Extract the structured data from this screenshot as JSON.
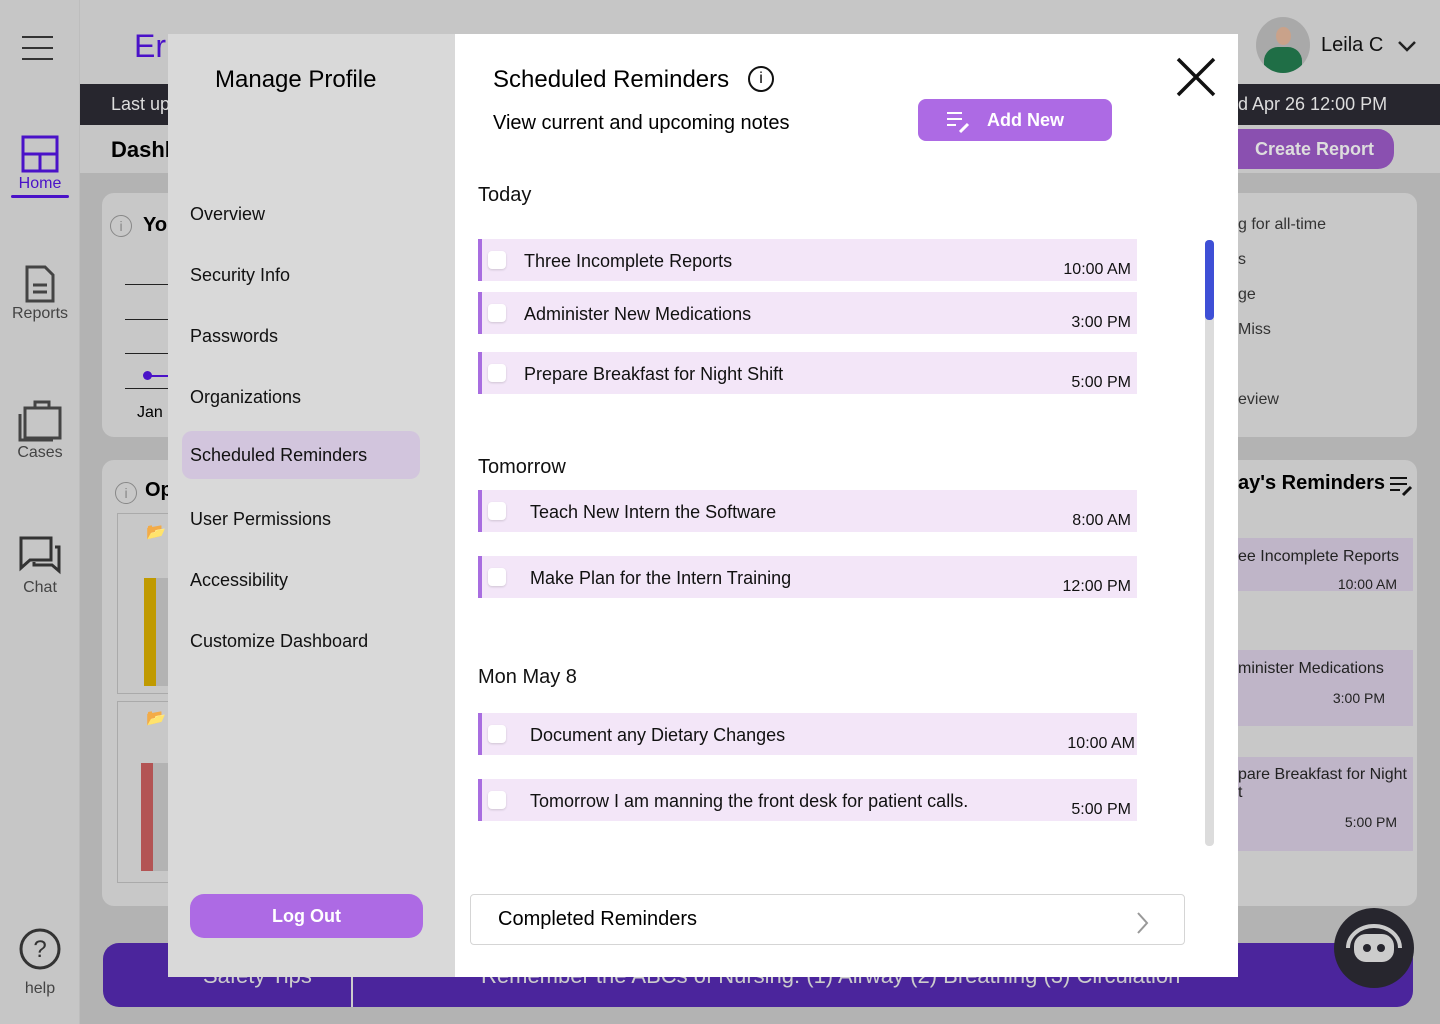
{
  "background": {
    "logo_fragment": "Err",
    "user_name": "Leila C",
    "last_updated_left": "Last up",
    "last_updated_right": "d Apr 26 12:00 PM",
    "dashboard_fragment": "Dashb",
    "create_report": "Create Report",
    "card1_title_fragment": "Yo",
    "card1_axis_label": "Jan",
    "card2_title_fragment": "Op",
    "stats_lines": [
      "g for all-time",
      "s",
      "ge",
      "Miss",
      "eview"
    ],
    "reminders_title": "ay's Reminders",
    "reminders": [
      {
        "title": "ee Incomplete Reports",
        "time": "10:00 AM"
      },
      {
        "title": "minister Medications",
        "time": "3:00 PM"
      },
      {
        "title": "pare Breakfast for Night\nt",
        "time": "5:00 PM"
      }
    ],
    "safety_tips": "Safety Tips",
    "safety_message": "Remember the ABCs of Nursing: (1) Airway (2) Breathing (3) Circulation",
    "nav": [
      {
        "label": "Home",
        "icon": "dashboard-icon"
      },
      {
        "label": "Reports",
        "icon": "document-icon"
      },
      {
        "label": "Cases",
        "icon": "briefcase-icon"
      },
      {
        "label": "Chat",
        "icon": "chat-icon"
      },
      {
        "label": "help",
        "icon": "help-icon"
      }
    ]
  },
  "profile_menu": {
    "title": "Manage Profile",
    "items": [
      "Overview",
      "Security Info",
      "Passwords",
      "Organizations",
      "Scheduled Reminders",
      "User Permissions",
      "Accessibility",
      "Customize Dashboard"
    ],
    "active": "Scheduled Reminders",
    "logout": "Log Out"
  },
  "panel": {
    "title": "Scheduled Reminders",
    "subtitle": "View current and upcoming notes",
    "add_new": "Add New",
    "completed": "Completed Reminders",
    "groups": [
      {
        "label": "Today",
        "items": [
          {
            "title": "Three Incomplete Reports",
            "time": "10:00 AM",
            "checked": false
          },
          {
            "title": "Administer New Medications",
            "time": "3:00 PM",
            "checked": false
          },
          {
            "title": "Prepare Breakfast for Night Shift",
            "time": "5:00 PM",
            "checked": false
          }
        ]
      },
      {
        "label": "Tomorrow",
        "items": [
          {
            "title": "Teach New Intern the Software",
            "time": "8:00 AM",
            "checked": false
          },
          {
            "title": "Make Plan for the Intern Training",
            "time": "12:00 PM",
            "checked": false
          }
        ]
      },
      {
        "label": "Mon May 8",
        "items": [
          {
            "title": "Document any Dietary Changes",
            "time": "10:00 AM",
            "checked": false
          },
          {
            "title": "Tomorrow I am manning the front desk for patient calls.",
            "time": "5:00 PM",
            "checked": false
          }
        ]
      }
    ]
  },
  "colors": {
    "accent": "#a86de0",
    "primary": "#4a12c8",
    "reminder_bg": "#f3e6f8"
  }
}
